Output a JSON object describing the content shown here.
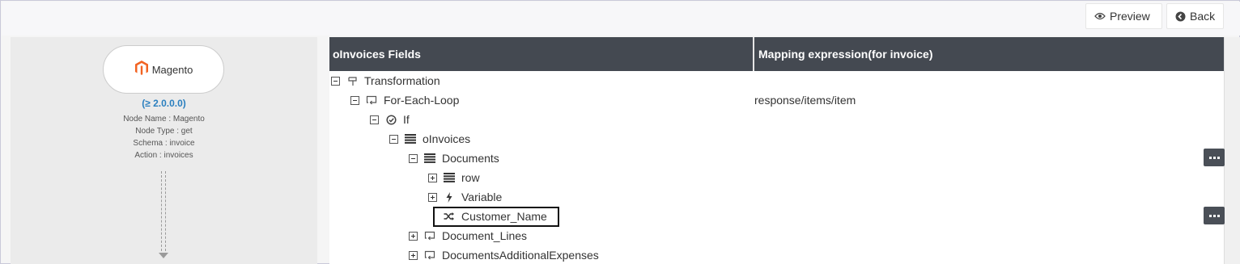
{
  "toolbar": {
    "preview_label": "Preview",
    "back_label": "Back"
  },
  "node": {
    "logo_text": "Magento",
    "version": "(≥ 2.0.0.0)",
    "name_line": "Node Name : Magento",
    "type_line": "Node Type : get",
    "schema_line": "Schema : invoice",
    "action_line": "Action : invoices",
    "brand_color": "#f26322"
  },
  "grid": {
    "col1_header": "oInvoices Fields",
    "col2_header": "Mapping expression(for invoice)",
    "rows": [
      {
        "label": "Transformation",
        "toggle": "minus",
        "icon": "transform-icon",
        "mapping": ""
      },
      {
        "label": "For-Each-Loop",
        "toggle": "minus",
        "icon": "loop-icon",
        "mapping": "response/items/item"
      },
      {
        "label": "If",
        "toggle": "minus",
        "icon": "check-circle-icon",
        "mapping": ""
      },
      {
        "label": "oInvoices",
        "toggle": "minus",
        "icon": "list-icon",
        "mapping": ""
      },
      {
        "label": "Documents",
        "toggle": "minus",
        "icon": "list-icon",
        "mapping": ""
      },
      {
        "label": "row",
        "toggle": "plus",
        "icon": "list-icon",
        "mapping": ""
      },
      {
        "label": "Variable",
        "toggle": "plus",
        "icon": "bolt-icon",
        "mapping": ""
      },
      {
        "label": "Customer_Name",
        "toggle": "none",
        "icon": "shuffle-icon",
        "mapping": ""
      },
      {
        "label": "Document_Lines",
        "toggle": "plus",
        "icon": "loop-icon",
        "mapping": ""
      },
      {
        "label": "DocumentsAdditionalExpenses",
        "toggle": "plus",
        "icon": "loop-icon",
        "mapping": ""
      }
    ]
  },
  "colors": {
    "header_bg": "#444951",
    "accent_blue": "#2a7fbf"
  }
}
